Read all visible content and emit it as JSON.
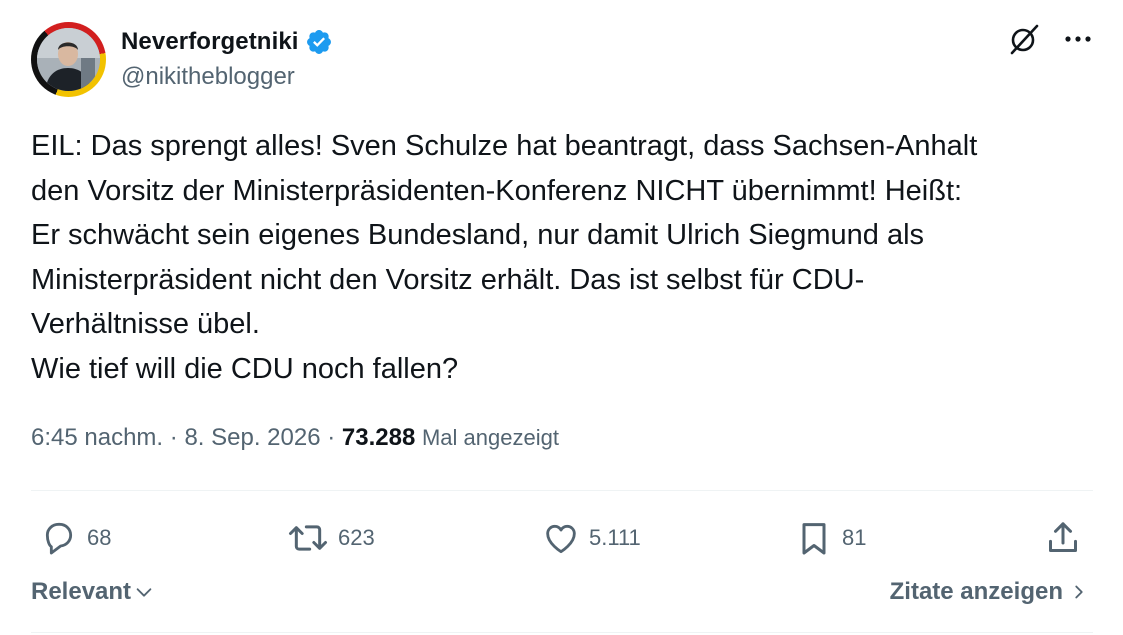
{
  "author": {
    "display_name": "Neverforgetniki",
    "handle": "@nikitheblogger",
    "verified": true,
    "avatar_icon": "profile-photo"
  },
  "tweet": {
    "text": "EIL: Das sprengt alles! Sven Schulze hat beantragt, dass Sachsen-Anhalt\nden Vorsitz der Ministerpräsidenten-Konferenz NICHT übernimmt! Heißt:\nEr schwächt sein eigenes Bundesland, nur damit Ulrich Siegmund als\nMinisterpräsident nicht den Vorsitz erhält. Das ist selbst für CDU-\nVerhältnisse übel.\nWie tief will die CDU noch fallen?",
    "time": "6:45 nachm.",
    "separator": "·",
    "date": "8. Sep. 2026",
    "views": "73.288",
    "views_label": "Mal angezeigt"
  },
  "actions": {
    "replies": "68",
    "reposts": "623",
    "likes": "5.111",
    "bookmarks": "81"
  },
  "footer": {
    "sort_label": "Relevant",
    "quotes_label": "Zitate anzeigen"
  },
  "icons": {
    "grok": "grok-icon",
    "more": "more-icon",
    "reply": "reply-icon",
    "repost": "repost-icon",
    "like": "like-icon",
    "bookmark": "bookmark-icon",
    "share": "share-icon"
  },
  "colors": {
    "verified": "#1d9bf0",
    "text_primary": "#0f1419",
    "text_secondary": "#536471",
    "divider": "#eff3f4"
  }
}
